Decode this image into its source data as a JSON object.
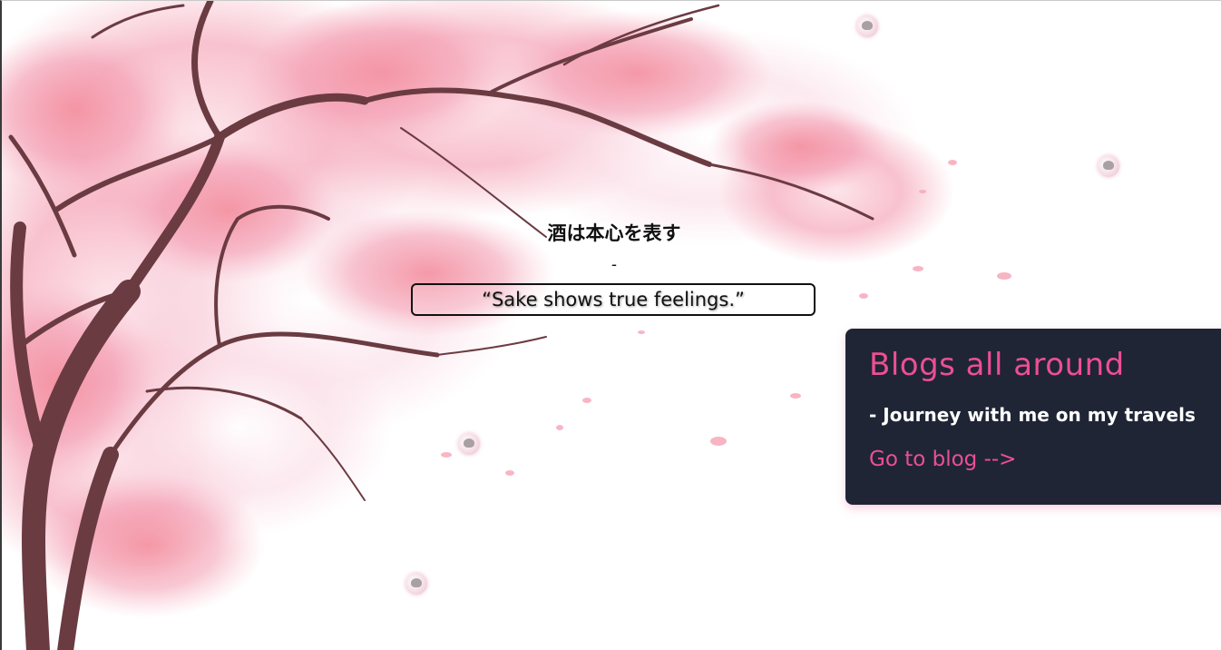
{
  "quote": {
    "japanese": "酒は本心を表す",
    "separator": "-",
    "english": "“Sake shows true feelings.”"
  },
  "blog_card": {
    "title": "Blogs all around",
    "subtitle": "- Journey with me on my travels",
    "link_label": "Go to blog -->"
  },
  "colors": {
    "card_background": "#1f2535",
    "accent_pink": "#ec4f92",
    "blossom_light": "#f9cbd6",
    "blossom_dark": "#ee7d94",
    "branch": "#6b3b42"
  },
  "decorations": {
    "background_image": "cherry-blossom-tree",
    "floating_items": "petal-bubble-icon"
  }
}
